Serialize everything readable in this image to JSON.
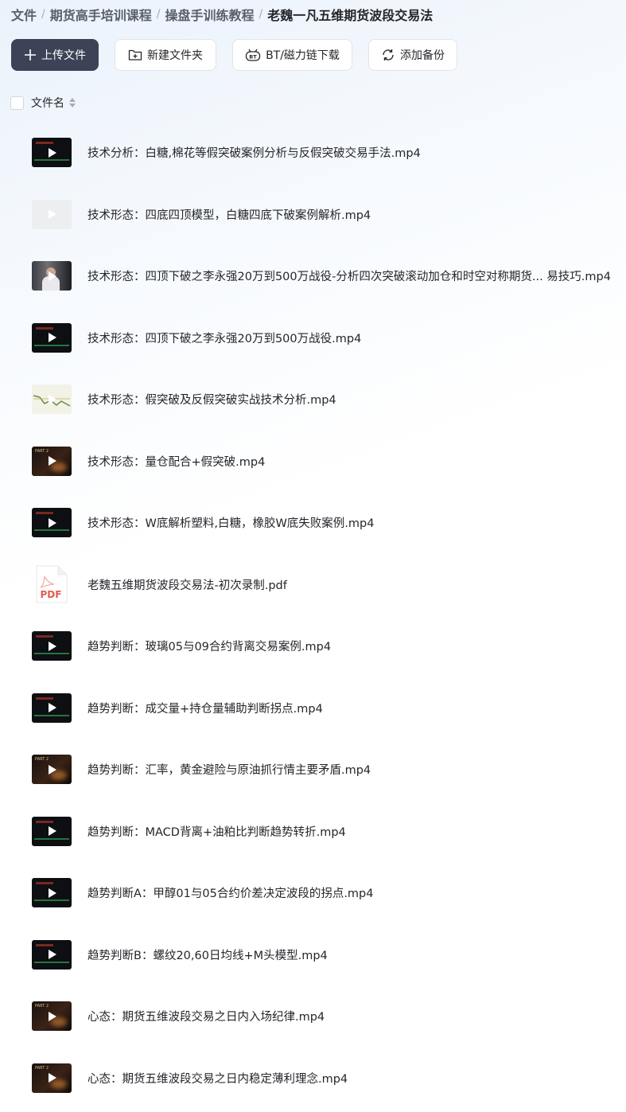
{
  "breadcrumb": {
    "items": [
      "文件",
      "期货高手培训课程",
      "操盘手训练教程",
      "老魏一凡五维期货波段交易法"
    ],
    "separator": "/"
  },
  "toolbar": {
    "upload_label": "上传文件",
    "new_folder_label": "新建文件夹",
    "bt_label": "BT/磁力链下载",
    "backup_label": "添加备份"
  },
  "list_header": {
    "name_label": "文件名"
  },
  "files": [
    {
      "name": "技术分析：白糖,棉花等假突破案例分析与反假突破交易手法.mp4",
      "thumb": "dark"
    },
    {
      "name": "技术形态：四底四顶模型，白糖四底下破案例解析.mp4",
      "thumb": "light"
    },
    {
      "name": "技术形态：四顶下破之李永强20万到500万战役-分析四次突破滚动加仓和时空对称期货...  易技巧.mp4",
      "thumb": "person"
    },
    {
      "name": "技术形态：四顶下破之李永强20万到500万战役.mp4",
      "thumb": "dark"
    },
    {
      "name": "技术形态：假突破及反假突破实战技术分析.mp4",
      "thumb": "chart"
    },
    {
      "name": "技术形态：量仓配合+假突破.mp4",
      "thumb": "part"
    },
    {
      "name": "技术形态：W底解析塑料,白糖，橡胶W底失败案例.mp4",
      "thumb": "dark"
    },
    {
      "name": "老魏五维期货波段交易法-初次录制.pdf",
      "thumb": "pdf"
    },
    {
      "name": "趋势判断：玻璃05与09合约背离交易案例.mp4",
      "thumb": "dark"
    },
    {
      "name": "趋势判断：成交量+持仓量辅助判断拐点.mp4",
      "thumb": "dark"
    },
    {
      "name": "趋势判断：汇率，黄金避险与原油抓行情主要矛盾.mp4",
      "thumb": "part"
    },
    {
      "name": "趋势判断：MACD背离+油粕比判断趋势转折.mp4",
      "thumb": "dark"
    },
    {
      "name": "趋势判断A：甲醇01与05合约价差决定波段的拐点.mp4",
      "thumb": "dark"
    },
    {
      "name": "趋势判断B：螺纹20,60日均线+M头模型.mp4",
      "thumb": "dark"
    },
    {
      "name": "心态：期货五维波段交易之日内入场纪律.mp4",
      "thumb": "part"
    },
    {
      "name": "心态：期货五维波段交易之日内稳定薄利理念.mp4",
      "thumb": "part"
    }
  ],
  "pdf_icon_text": "PDF",
  "part_text": "PART 2"
}
